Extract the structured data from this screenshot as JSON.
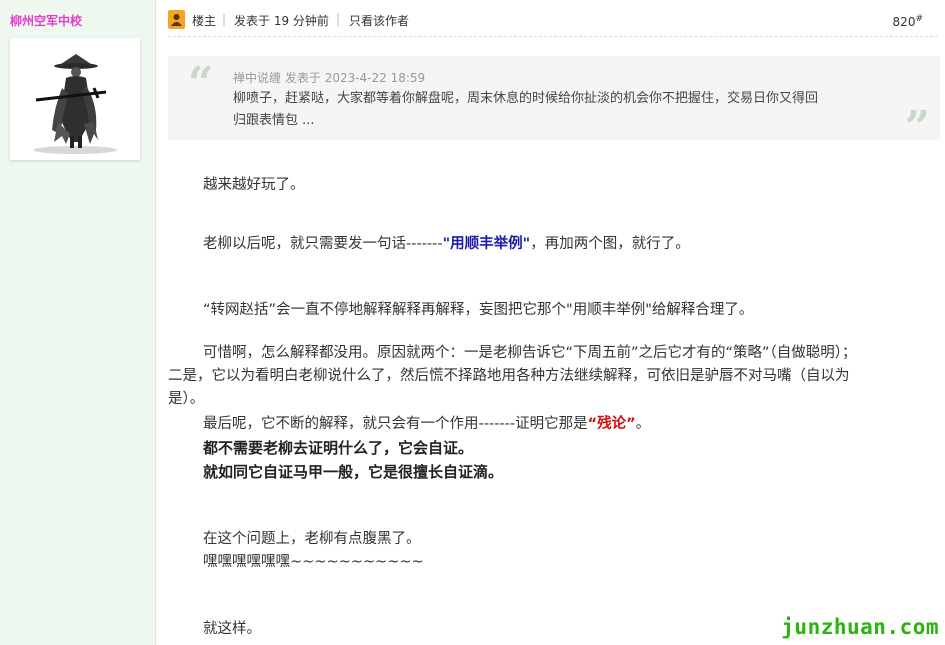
{
  "sidebar": {
    "author_name": "柳州空军中校"
  },
  "post_header": {
    "role": "楼主",
    "posted": "发表于 19 分钟前",
    "only_author": "只看该作者",
    "floor_number": "820",
    "floor_mark": "#"
  },
  "quote": {
    "author": "禅中说缠",
    "posted_label": "发表于",
    "date": "2023-4-22 18:59",
    "line1": "柳喷子，赶紧哒，大家都等着你解盘呢，周末休息的时候给你扯淡的机会你不把握住，交易日你又得回",
    "line2": "归跟表情包 ..."
  },
  "content": {
    "p1": "越来越好玩了。",
    "p2_before": "老柳以后呢，就只需要发一句话-------",
    "p2_highlight": "\"用顺丰举例\"",
    "p2_after": "，再加两个图，就行了。",
    "p3": "“转网赵括”会一直不停地解释解释再解释，妄图把它那个\"用顺丰举例\"给解释合理了。",
    "p4_line1": "可惜啊，怎么解释都没用。原因就两个：一是老柳告诉它“下周五前”之后它才有的“策略”（自做聪明）；",
    "p4_line2": "二是，它以为看明白老柳说什么了，然后慌不择路地用各种方法继续解释，可依旧是驴唇不对马嘴（自以为",
    "p4_line3": "是）。",
    "p5_before": "最后呢，它不断的解释，就只会有一个作用-------证明它那是",
    "p5_highlight": "“残论”",
    "p5_after": "。",
    "p6": "都不需要老柳去证明什么了，它会自证。",
    "p7": "就如同它自证马甲一般，它是很擅长自证滴。",
    "p8": "在这个问题上，老柳有点腹黑了。",
    "p9": "嘿嘿嘿嘿嘿嘿~~~~~~~~~~~",
    "p10": "就这样。"
  },
  "watermark": "junzhuan.com",
  "colors": {
    "sidebar_bg": "#eef8ef",
    "author_name": "#e03fcc",
    "highlight_blue": "#1a1aa8",
    "highlight_red": "#d40f0f",
    "watermark": "#2bb30f",
    "quote_bg": "#f5f5f5"
  }
}
